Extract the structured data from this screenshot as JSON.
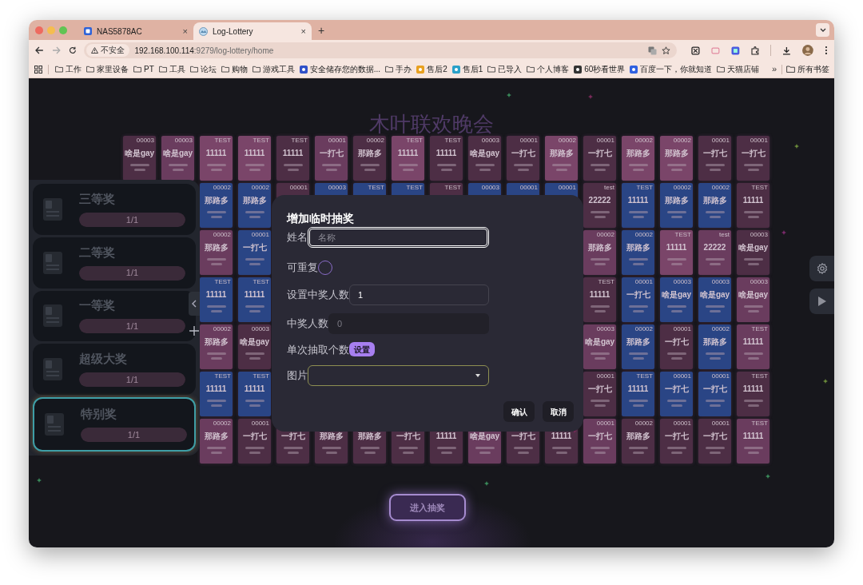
{
  "browser": {
    "tabs": [
      {
        "title": "NAS5878AC",
        "close": "×",
        "selected": false
      },
      {
        "title": "Log-Lottery",
        "close": "×",
        "selected": true
      }
    ],
    "new_tab": "+",
    "address": {
      "security": "不安全",
      "host": "192.168.100.114",
      "path": ":9279/log-lottery/home"
    },
    "bookmarks": [
      {
        "label": "工作",
        "kind": "folder"
      },
      {
        "label": "家里设备",
        "kind": "folder"
      },
      {
        "label": "PT",
        "kind": "folder"
      },
      {
        "label": "工具",
        "kind": "folder"
      },
      {
        "label": "论坛",
        "kind": "folder"
      },
      {
        "label": "购物",
        "kind": "folder"
      },
      {
        "label": "游戏工具",
        "kind": "folder"
      },
      {
        "label": "安全储存您的数据...",
        "kind": "site"
      },
      {
        "label": "手办",
        "kind": "folder"
      },
      {
        "label": "售后2",
        "kind": "site"
      },
      {
        "label": "售后1",
        "kind": "site"
      },
      {
        "label": "已导入",
        "kind": "folder"
      },
      {
        "label": "个人博客",
        "kind": "folder"
      },
      {
        "label": "60秒看世界",
        "kind": "site"
      },
      {
        "label": "百度一下，你就知道",
        "kind": "site"
      },
      {
        "label": "天猫店铺",
        "kind": "folder"
      }
    ],
    "more": "»",
    "all_bookmarks": "所有书签"
  },
  "page": {
    "title": "木叶联欢晚会",
    "rows": [
      {
        "left_cards": [
          {
            "code": "00003",
            "title": "啥是gay",
            "color": "#4d2e45"
          },
          {
            "code": "00003",
            "title": "啥是gay",
            "color": "#6a3c5e"
          },
          {
            "code": "TEST",
            "title": "11111",
            "color": "#7a4569"
          },
          {
            "code": "TEST",
            "title": "11111",
            "color": "#7a4569"
          },
          {
            "code": "TEST",
            "title": "11111",
            "color": "#4d2e45"
          },
          {
            "code": "00001",
            "title": "一打七",
            "color": "#6a3c5e"
          },
          {
            "code": "00002",
            "title": "那路多",
            "color": "#4d2e45"
          },
          {
            "code": "TEST",
            "title": "11111",
            "color": "#7a4569"
          },
          {
            "code": "TEST",
            "title": "11111",
            "color": "#4d2e45"
          },
          {
            "code": "00003",
            "title": "啥是gay",
            "color": "#4d2e45"
          },
          {
            "code": "00001",
            "title": "一打七",
            "color": "#4d2e45"
          },
          {
            "code": "00002",
            "title": "那路多",
            "color": "#7a4569"
          },
          {
            "code": "00001",
            "title": "一打七",
            "color": "#4d2e45"
          },
          {
            "code": "00002",
            "title": "那路多",
            "color": "#7a4569"
          },
          {
            "code": "00002",
            "title": "那路多",
            "color": "#7a4569"
          },
          {
            "code": "00001",
            "title": "一打七",
            "color": "#4d2e45"
          },
          {
            "code": "00001",
            "title": "一打七",
            "color": "#4d2e45"
          }
        ]
      },
      {
        "left_cards": [
          {
            "code": "00002",
            "title": "那路多",
            "color": "#2a4585"
          },
          {
            "code": "00002",
            "title": "那路多",
            "color": "#2a4585"
          },
          {
            "code": "00001",
            "color": "#4d2e45"
          },
          {
            "code": "00003",
            "color": "#2a4585"
          },
          {
            "code": "TEST",
            "color": "#2a4585"
          },
          {
            "code": "TEST",
            "color": "#2a4585"
          },
          {
            "code": "TEST",
            "color": "#4d2e45"
          },
          {
            "code": "00003",
            "color": "#2a4585"
          },
          {
            "code": "00001",
            "color": "#2a4585"
          },
          {
            "code": "00001",
            "color": "#2a4585"
          },
          {
            "code": "test",
            "title": "22222",
            "color": "#4d2e45"
          },
          {
            "code": "TEST",
            "title": "11111",
            "color": "#2a4585"
          },
          {
            "code": "00002",
            "title": "那路多",
            "color": "#2a4585"
          },
          {
            "code": "00002",
            "title": "那路多",
            "color": "#2a4585"
          },
          {
            "code": "TEST",
            "title": "11111",
            "color": "#4d2e45"
          }
        ]
      },
      {
        "left_cards": [
          {
            "code": "00002",
            "title": "那路多",
            "color": "#6a3c5e"
          },
          {
            "code": "00001",
            "title": "一打七",
            "color": "#2a4585"
          }
        ],
        "right_cards": [
          {
            "code": "00002",
            "title": "那路多",
            "color": "#6a3c5e"
          },
          {
            "code": "00002",
            "title": "那路多",
            "color": "#2a4585"
          },
          {
            "code": "TEST",
            "title": "11111",
            "color": "#7a4569"
          },
          {
            "code": "test",
            "title": "22222",
            "color": "#6a3c5e"
          },
          {
            "code": "00003",
            "title": "啥是gay",
            "color": "#4d2e45"
          }
        ]
      },
      {
        "left_cards": [
          {
            "code": "TEST",
            "title": "11111",
            "color": "#2a4585"
          },
          {
            "code": "TEST",
            "title": "11111",
            "color": "#2a4585"
          }
        ],
        "right_cards": [
          {
            "code": "TEST",
            "title": "11111",
            "color": "#4d2e45"
          },
          {
            "code": "00001",
            "title": "一打七",
            "color": "#2a4585"
          },
          {
            "code": "00003",
            "title": "啥是gay",
            "color": "#2a4585"
          },
          {
            "code": "00003",
            "title": "啥是gay",
            "color": "#2a4585"
          },
          {
            "code": "00003",
            "title": "啥是gay",
            "color": "#6a3c5e"
          }
        ]
      },
      {
        "left_cards": [
          {
            "code": "00002",
            "title": "那路多",
            "color": "#6a3c5e"
          },
          {
            "code": "00003",
            "title": "啥是gay",
            "color": "#4d2e45"
          }
        ],
        "right_cards": [
          {
            "code": "00003",
            "title": "啥是gay",
            "color": "#6a3c5e"
          },
          {
            "code": "00002",
            "title": "那路多",
            "color": "#2a4585"
          },
          {
            "code": "00001",
            "title": "一打七",
            "color": "#4d2e45"
          },
          {
            "code": "00002",
            "title": "那路多",
            "color": "#2a4585"
          },
          {
            "code": "TEST",
            "title": "11111",
            "color": "#6a3c5e"
          }
        ]
      },
      {
        "left_cards": [
          {
            "code": "TEST",
            "title": "11111",
            "color": "#2a4585"
          },
          {
            "code": "TEST",
            "title": "11111",
            "color": "#2a4585"
          }
        ],
        "right_cards": [
          {
            "code": "00001",
            "title": "一打七",
            "color": "#4d2e45"
          },
          {
            "code": "TEST",
            "title": "11111",
            "color": "#2a4585"
          },
          {
            "code": "00001",
            "title": "一打七",
            "color": "#2a4585"
          },
          {
            "code": "00001",
            "title": "一打七",
            "color": "#2a4585"
          },
          {
            "code": "TEST",
            "title": "11111",
            "color": "#4d2e45"
          }
        ]
      },
      {
        "left_cards": [
          {
            "code": "00002",
            "title": "那路多",
            "color": "#6a3c5e"
          },
          {
            "code": "00001",
            "title": "一打七",
            "color": "#4d2e45"
          },
          {
            "title": "一打七",
            "color": "#4d2e45"
          },
          {
            "title": "那路多",
            "color": "#4d2e45"
          },
          {
            "title": "那路多",
            "color": "#4d2e45"
          },
          {
            "title": "一打七",
            "color": "#4d2e45"
          },
          {
            "title": "11111",
            "color": "#4d2e45"
          },
          {
            "title": "啥是gay",
            "color": "#6a3c5e"
          },
          {
            "title": "一打七",
            "color": "#4d2e45"
          },
          {
            "title": "11111",
            "color": "#4d2e45"
          },
          {
            "code": "00001",
            "title": "一打七",
            "color": "#6a3c5e"
          },
          {
            "code": "00002",
            "title": "那路多",
            "color": "#4d2e45"
          },
          {
            "code": "00001",
            "title": "一打七",
            "color": "#4d2e45"
          },
          {
            "code": "00001",
            "title": "一打七",
            "color": "#4d2e45"
          },
          {
            "code": "TEST",
            "title": "11111",
            "color": "#6a3c5e"
          }
        ]
      }
    ],
    "prizes": [
      {
        "name": "三等奖",
        "progress": "1/1",
        "level": 1,
        "selected": false
      },
      {
        "name": "二等奖",
        "progress": "1/1",
        "level": 1,
        "selected": false
      },
      {
        "name": "一等奖",
        "progress": "1/1",
        "level": 1,
        "selected": false
      },
      {
        "name": "超级大奖",
        "progress": "1/1",
        "level": 1,
        "selected": false
      },
      {
        "name": "特别奖",
        "progress": "1/1",
        "level": 1,
        "selected": true
      }
    ],
    "dialog": {
      "title": "增加临时抽奖",
      "fields": [
        {
          "kind": "text",
          "label": "姓名",
          "placeholder": "名称",
          "focused": true,
          "disabled": false
        },
        {
          "kind": "check",
          "label": "可重复",
          "checked": false
        },
        {
          "kind": "text",
          "label": "设置中奖人数",
          "value": "1",
          "focused": false,
          "disabled": false
        },
        {
          "kind": "text",
          "label": "中奖人数",
          "value": "0",
          "focused": false,
          "disabled": true
        },
        {
          "kind": "action",
          "label": "单次抽取个数",
          "button": "设置"
        },
        {
          "kind": "select",
          "label": "图片"
        }
      ],
      "buttons": [
        "确认",
        "取消"
      ]
    },
    "enter_button": "进入抽奖"
  }
}
